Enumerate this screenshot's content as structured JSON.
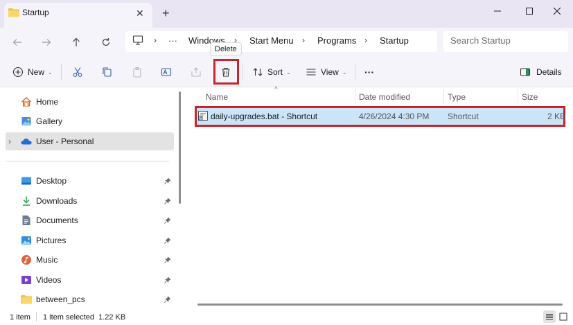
{
  "window": {
    "tab_title": "Startup",
    "new_tab": "+",
    "close_tab": "✕"
  },
  "address": {
    "overflow": "···",
    "crumbs": [
      "Windows",
      "Start Menu",
      "Programs",
      "Startup"
    ],
    "search_placeholder": "Search Startup"
  },
  "toolbar": {
    "new_label": "New",
    "sort_label": "Sort",
    "view_label": "View",
    "more_label": "···",
    "details_label": "Details",
    "tooltip": "Delete"
  },
  "sidebar": {
    "top_items": [
      {
        "label": "Home",
        "icon": "home-icon"
      },
      {
        "label": "Gallery",
        "icon": "gallery-icon"
      },
      {
        "label": "User - Personal",
        "icon": "onedrive-icon",
        "selected": true
      }
    ],
    "pinned_items": [
      {
        "label": "Desktop",
        "icon": "desktop-icon"
      },
      {
        "label": "Downloads",
        "icon": "downloads-icon"
      },
      {
        "label": "Documents",
        "icon": "documents-icon"
      },
      {
        "label": "Pictures",
        "icon": "pictures-icon"
      },
      {
        "label": "Music",
        "icon": "music-icon"
      },
      {
        "label": "Videos",
        "icon": "videos-icon"
      },
      {
        "label": "between_pcs",
        "icon": "folder-icon"
      }
    ]
  },
  "table": {
    "columns": [
      "Name",
      "Date modified",
      "Type",
      "Size"
    ],
    "rows": [
      {
        "name": "daily-upgrades.bat - Shortcut",
        "date": "4/26/2024 4:30 PM",
        "type": "Shortcut",
        "size": "2 KB"
      }
    ]
  },
  "status": {
    "items": "1 item",
    "selected": "1 item selected  1.22 KB"
  },
  "colors": {
    "highlight": "#c8242c",
    "selection": "#cce4f7",
    "chrome": "#f6f4fb",
    "folder": "#f4c046"
  }
}
